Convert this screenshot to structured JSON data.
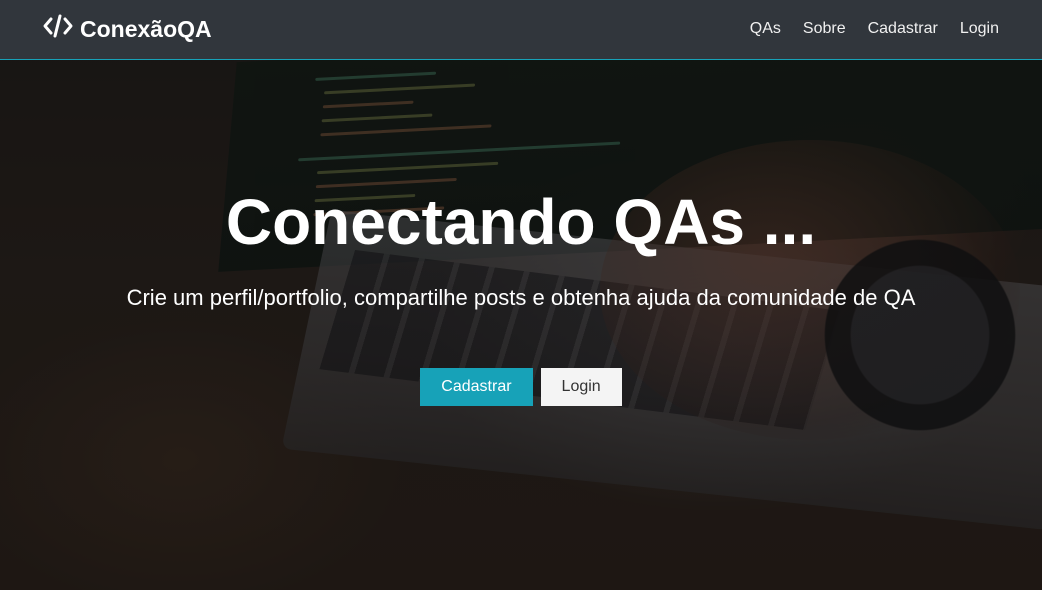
{
  "navbar": {
    "brand_icon": "code-icon",
    "brand_label": "ConexãoQA",
    "links": [
      {
        "label": "QAs"
      },
      {
        "label": "Sobre"
      },
      {
        "label": "Cadastrar"
      },
      {
        "label": "Login"
      }
    ]
  },
  "hero": {
    "title": "Conectando QAs ...",
    "subtitle": "Crie um perfil/portfolio, compartilhe posts e obtenha ajuda da comunidade de QA",
    "register_button": "Cadastrar",
    "login_button": "Login"
  },
  "colors": {
    "accent": "#17a2b8",
    "navbar_bg": "#343a40",
    "light_button": "#f4f4f4"
  }
}
